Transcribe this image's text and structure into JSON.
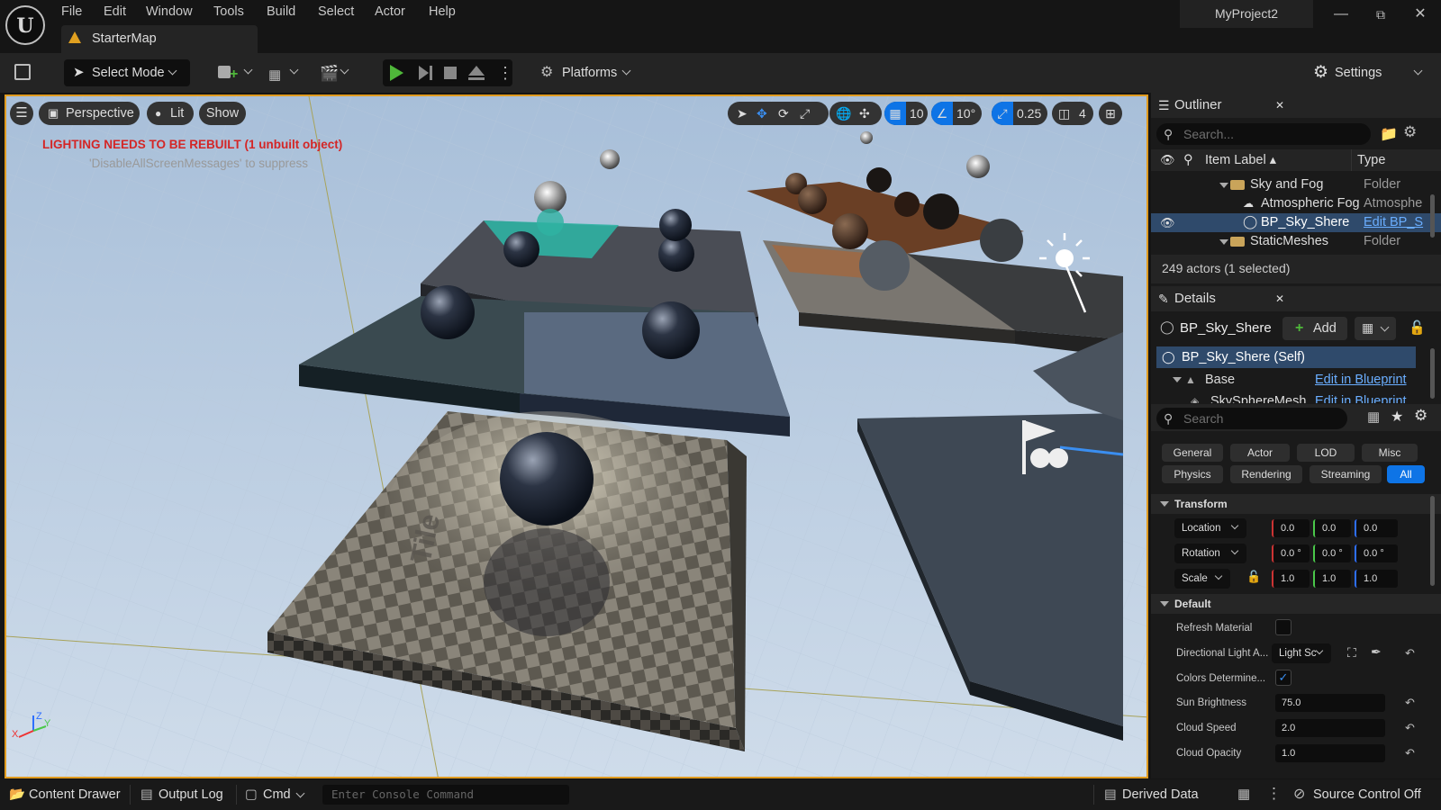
{
  "window": {
    "project": "MyProject2"
  },
  "menu": [
    "File",
    "Edit",
    "Window",
    "Tools",
    "Build",
    "Select",
    "Actor",
    "Help"
  ],
  "tab": {
    "label": "StarterMap"
  },
  "toolbar": {
    "select_mode": "Select Mode",
    "platforms": "Platforms",
    "settings": "Settings"
  },
  "viewport": {
    "perspective": "Perspective",
    "lit": "Lit",
    "show": "Show",
    "grid_snap": "10",
    "rotation_snap": "10°",
    "scale_snap": "0.25",
    "camera_speed": "4",
    "warning_text": "LIGHTING NEEDS TO BE REBUILT (1 unbuilt object)",
    "suppress_text": "'DisableAllScreenMessages' to suppress",
    "tile_text": "Tile",
    "axis_z": "Z",
    "axis_y": "Y",
    "axis_x": "X"
  },
  "outliner": {
    "title": "Outliner",
    "search_placeholder": "Search...",
    "col_label": "Item Label ▴",
    "col_type": "Type",
    "rows": [
      {
        "label": "Sky and Fog",
        "type": "Folder"
      },
      {
        "label": "Atmospheric Fog",
        "type": "Atmosphe"
      },
      {
        "label": "BP_Sky_Shere",
        "type": "Edit BP_S"
      },
      {
        "label": "StaticMeshes",
        "type": "Folder"
      }
    ],
    "status": "249 actors (1 selected)"
  },
  "details": {
    "title": "Details",
    "actor_name": "BP_Sky_Shere",
    "add_label": "Add",
    "components": [
      {
        "label": "BP_Sky_Shere (Self)",
        "link": ""
      },
      {
        "label": "Base",
        "link": "Edit in Blueprint"
      },
      {
        "label": "SkySphereMesh",
        "link": "Edit in Blueprint"
      }
    ],
    "search_placeholder": "Search",
    "categories": [
      "General",
      "Actor",
      "LOD",
      "Misc",
      "Physics",
      "Rendering",
      "Streaming",
      "All"
    ],
    "transform": {
      "section": "Transform",
      "location": {
        "label": "Location",
        "x": "0.0",
        "y": "0.0",
        "z": "0.0"
      },
      "rotation": {
        "label": "Rotation",
        "x": "0.0 °",
        "y": "0.0 °",
        "z": "0.0 °"
      },
      "scale": {
        "label": "Scale",
        "x": "1.0",
        "y": "1.0",
        "z": "1.0"
      }
    },
    "default": {
      "section": "Default",
      "refresh_material": "Refresh Material",
      "directional_light": "Directional Light A...",
      "directional_light_value": "Light Sc",
      "colors_determined": "Colors Determine...",
      "sun_brightness": {
        "label": "Sun Brightness",
        "value": "75.0"
      },
      "cloud_speed": {
        "label": "Cloud Speed",
        "value": "2.0"
      },
      "cloud_opacity": {
        "label": "Cloud Opacity",
        "value": "1.0"
      }
    }
  },
  "statusbar": {
    "content_drawer": "Content Drawer",
    "output_log": "Output Log",
    "cmd": "Cmd",
    "console_placeholder": "Enter Console Command",
    "derived_data": "Derived Data",
    "source_control": "Source Control Off"
  },
  "colors": {
    "accent_orange": "#e09b1f",
    "select_blue": "#2f4a6b",
    "play_green": "#4fb83a",
    "all_blue": "#0e74e6"
  }
}
